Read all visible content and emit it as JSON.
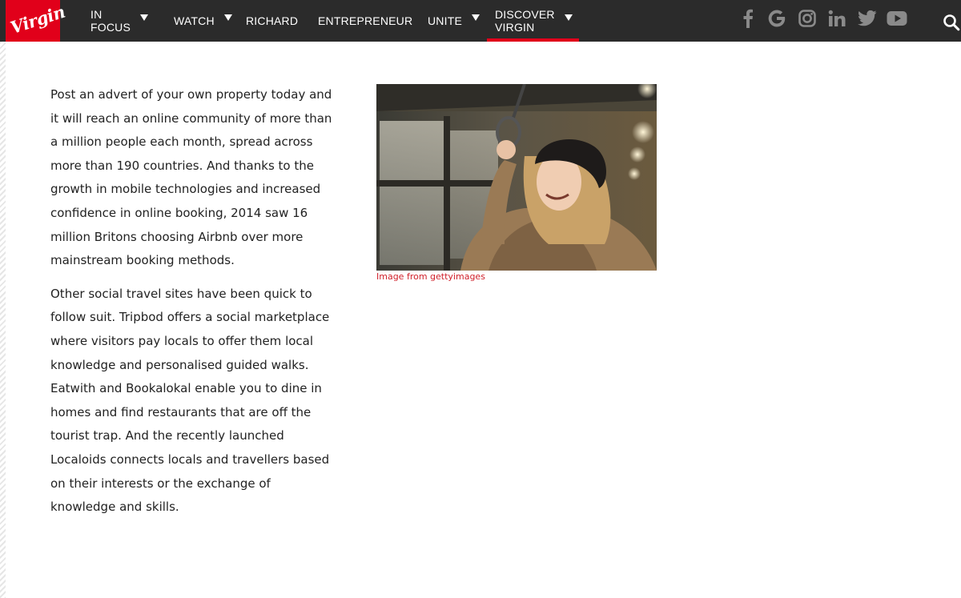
{
  "brand": {
    "logo_text": "Virgin",
    "accent_color": "#e1001a",
    "nav_bg": "#2b2b2b"
  },
  "nav": {
    "items": [
      {
        "label": "IN FOCUS",
        "has_dropdown": true
      },
      {
        "label": "WATCH",
        "has_dropdown": true
      },
      {
        "label": "RICHARD",
        "has_dropdown": false
      },
      {
        "label": "ENTREPRENEUR",
        "has_dropdown": false
      },
      {
        "label": "UNITE",
        "has_dropdown": true
      },
      {
        "label": "DISCOVER VIRGIN",
        "has_dropdown": true,
        "active": true
      }
    ]
  },
  "social": [
    "facebook-icon",
    "google-icon",
    "instagram-icon",
    "linkedin-icon",
    "twitter-icon",
    "youtube-icon"
  ],
  "article": {
    "paragraphs": [
      "Post an advert of your own property today and it will reach an online community of more than a million people each month, spread across more than 190 countries. And thanks to the growth in mobile technologies and increased confidence in online booking, 2014 saw 16 million Britons choosing Airbnb over more mainstream booking methods.",
      "Other social travel sites have been quick to follow suit. Tripbod offers a social marketplace where visitors pay locals to offer them local knowledge and personalised guided walks. Eatwith and Bookalokal enable you to dine in homes and find restaurants that are off the tourist trap. And the recently launched Localoids connects locals and travellers based on their interests or the exchange of knowledge and skills."
    ]
  },
  "figure": {
    "caption": "Image from gettyimages"
  }
}
